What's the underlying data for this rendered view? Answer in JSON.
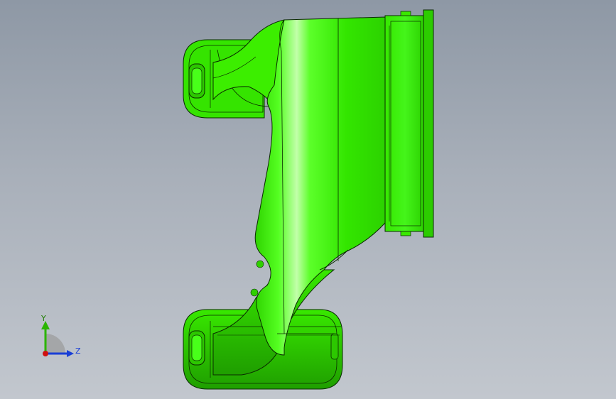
{
  "viewport": {
    "model_name": "",
    "colors": {
      "background_top": "#8e98a5",
      "background_bottom": "#c2c7ce",
      "part_fill": "#33e000",
      "part_highlight": "#b8ff9a",
      "part_shadow": "#1fa800",
      "edge": "#0a2a00"
    }
  },
  "triad": {
    "y_label": "Y",
    "z_label": "Z",
    "icons": [
      "view-orientation-triad-icon"
    ],
    "colors": {
      "y_axis": "#2bb500",
      "z_axis": "#1a3fd6",
      "origin": "#d01010",
      "arc": "#8a8a8a"
    }
  }
}
